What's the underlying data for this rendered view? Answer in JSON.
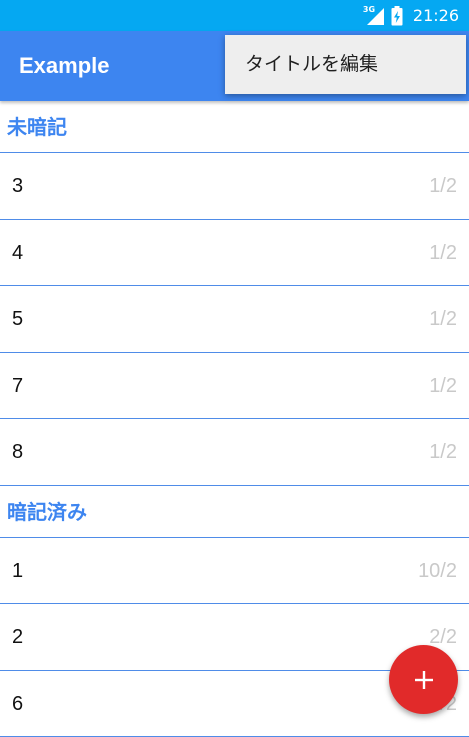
{
  "status_bar": {
    "network": "3G",
    "time": "21:26",
    "icons": [
      "signal-icon",
      "battery-charging-icon"
    ]
  },
  "app_bar": {
    "title": "Example",
    "color": "#3d85f0"
  },
  "popup_menu": {
    "items": [
      {
        "label": "タイトルを編集"
      }
    ]
  },
  "sections": [
    {
      "title": "未暗記",
      "items": [
        {
          "label": "3",
          "progress": "1/2"
        },
        {
          "label": "4",
          "progress": "1/2"
        },
        {
          "label": "5",
          "progress": "1/2"
        },
        {
          "label": "7",
          "progress": "1/2"
        },
        {
          "label": "8",
          "progress": "1/2"
        }
      ]
    },
    {
      "title": "暗記済み",
      "items": [
        {
          "label": "1",
          "progress": "10/2"
        },
        {
          "label": "2",
          "progress": "2/2"
        },
        {
          "label": "6",
          "progress": "2/2"
        }
      ]
    }
  ],
  "fab": {
    "icon": "plus-icon",
    "color": "#e12a2a"
  }
}
